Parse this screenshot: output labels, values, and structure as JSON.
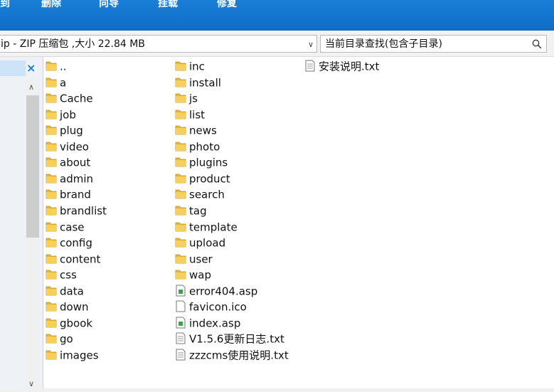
{
  "toolbar": {
    "buttons": [
      {
        "label": "到"
      },
      {
        "label": "删除"
      },
      {
        "label": "向导"
      },
      {
        "label": "挂载"
      },
      {
        "label": "修复"
      }
    ]
  },
  "address_bar": {
    "path_text": "ip - ZIP 压缩包 ,大小 22.84 MB",
    "search_placeholder": "当前目录查找(包含子目录)"
  },
  "colors": {
    "toolbar": "#0f6cc6",
    "folder": "#e8b83a",
    "accent": "#1a7fd6"
  },
  "files": [
    {
      "name": "..",
      "type": "folder"
    },
    {
      "name": "a",
      "type": "folder"
    },
    {
      "name": "Cache",
      "type": "folder"
    },
    {
      "name": "job",
      "type": "folder"
    },
    {
      "name": "plug",
      "type": "folder"
    },
    {
      "name": "video",
      "type": "folder"
    },
    {
      "name": "about",
      "type": "folder"
    },
    {
      "name": "admin",
      "type": "folder"
    },
    {
      "name": "brand",
      "type": "folder"
    },
    {
      "name": "brandlist",
      "type": "folder"
    },
    {
      "name": "case",
      "type": "folder"
    },
    {
      "name": "config",
      "type": "folder"
    },
    {
      "name": "content",
      "type": "folder"
    },
    {
      "name": "css",
      "type": "folder"
    },
    {
      "name": "data",
      "type": "folder"
    },
    {
      "name": "down",
      "type": "folder"
    },
    {
      "name": "gbook",
      "type": "folder"
    },
    {
      "name": "go",
      "type": "folder"
    },
    {
      "name": "images",
      "type": "folder"
    },
    {
      "name": "inc",
      "type": "folder"
    },
    {
      "name": "install",
      "type": "folder"
    },
    {
      "name": "js",
      "type": "folder"
    },
    {
      "name": "list",
      "type": "folder"
    },
    {
      "name": "news",
      "type": "folder"
    },
    {
      "name": "photo",
      "type": "folder"
    },
    {
      "name": "plugins",
      "type": "folder"
    },
    {
      "name": "product",
      "type": "folder"
    },
    {
      "name": "search",
      "type": "folder"
    },
    {
      "name": "tag",
      "type": "folder"
    },
    {
      "name": "template",
      "type": "folder"
    },
    {
      "name": "upload",
      "type": "folder"
    },
    {
      "name": "user",
      "type": "folder"
    },
    {
      "name": "wap",
      "type": "folder"
    },
    {
      "name": "error404.asp",
      "type": "asp"
    },
    {
      "name": "favicon.ico",
      "type": "file"
    },
    {
      "name": "index.asp",
      "type": "asp"
    },
    {
      "name": "V1.5.6更新日志.txt",
      "type": "txt"
    },
    {
      "name": "zzzcms使用说明.txt",
      "type": "txt"
    },
    {
      "name": "安装说明.txt",
      "type": "txt"
    }
  ]
}
